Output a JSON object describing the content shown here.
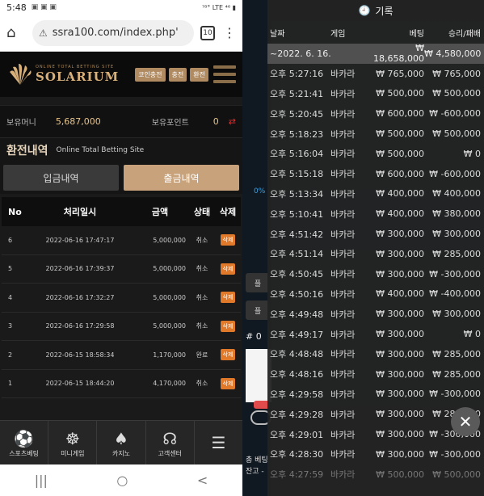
{
  "left": {
    "status": {
      "time": "5:48",
      "icons": "▣ ▣ ▣",
      "right": "⁷⁸° LTE ⁴⁶ ▮"
    },
    "browser": {
      "url": "ssra100.com/index.php'",
      "tab_count": "10"
    },
    "site": {
      "brand_tag": "ONLINE TOTAL BETTING SITE",
      "brand_name": "SOLARIUM",
      "buttons": [
        "코인충전",
        "충전",
        "환전"
      ]
    },
    "balance": {
      "money_label": "보유머니",
      "money": "5,687,000",
      "points_label": "보유포인트",
      "points": "0",
      "transfer_icon": "⇄"
    },
    "section": {
      "title": "환전내역",
      "subtitle": "Online Total Betting Site"
    },
    "tabs": [
      "입금내역",
      "출금내역"
    ],
    "table": {
      "headers": [
        "No",
        "처리일시",
        "금액",
        "상태",
        "삭제"
      ],
      "rows": [
        {
          "no": "6",
          "datetime": "2022-06-16 17:47:17",
          "amount": "5,000,000",
          "status": "취소",
          "del": "삭제"
        },
        {
          "no": "5",
          "datetime": "2022-06-16 17:39:37",
          "amount": "5,000,000",
          "status": "취소",
          "del": "삭제"
        },
        {
          "no": "4",
          "datetime": "2022-06-16 17:32:27",
          "amount": "5,000,000",
          "status": "취소",
          "del": "삭제"
        },
        {
          "no": "3",
          "datetime": "2022-06-16 17:29:58",
          "amount": "5,000,000",
          "status": "취소",
          "del": "삭제"
        },
        {
          "no": "2",
          "datetime": "2022-06-15 18:58:34",
          "amount": "1,170,000",
          "status": "완료",
          "del": "삭제"
        },
        {
          "no": "1",
          "datetime": "2022-06-15 18:44:20",
          "amount": "4,170,000",
          "status": "취소",
          "del": "삭제"
        }
      ]
    },
    "bottomnav": [
      {
        "label": "스포츠베팅",
        "icon": "⚽"
      },
      {
        "label": "미니게임",
        "icon": "☸"
      },
      {
        "label": "카지노",
        "icon": "♠"
      },
      {
        "label": "고객센터",
        "icon": "☊"
      },
      {
        "label": "",
        "icon": "☰"
      }
    ],
    "sysnav": [
      "|||",
      "○",
      "<"
    ]
  },
  "right": {
    "side": {
      "pct": "0%",
      "chip1": "플",
      "chip2": "플",
      "hash": "# 0",
      "line1": "총 베팅",
      "line2": "잔고 -"
    },
    "title": "기록",
    "headers": [
      "날짜",
      "게임",
      "베팅",
      "승리/패배"
    ],
    "summary": {
      "date": "~2022. 6. 16.",
      "game": "",
      "bet": "₩ 18,658,000",
      "win": "₩ 4,580,000"
    },
    "rows": [
      {
        "date": "오후 5:27:16",
        "game": "바카라",
        "bet": "₩ 765,000",
        "win": "₩ 765,000"
      },
      {
        "date": "오후 5:21:41",
        "game": "바카라",
        "bet": "₩ 500,000",
        "win": "₩ 500,000"
      },
      {
        "date": "오후 5:20:45",
        "game": "바카라",
        "bet": "₩ 600,000",
        "win": "₩ -600,000"
      },
      {
        "date": "오후 5:18:23",
        "game": "바카라",
        "bet": "₩ 500,000",
        "win": "₩ 500,000"
      },
      {
        "date": "오후 5:16:04",
        "game": "바카라",
        "bet": "₩ 500,000",
        "win": "₩ 0"
      },
      {
        "date": "오후 5:15:18",
        "game": "바카라",
        "bet": "₩ 600,000",
        "win": "₩ -600,000"
      },
      {
        "date": "오후 5:13:34",
        "game": "바카라",
        "bet": "₩ 400,000",
        "win": "₩ 400,000"
      },
      {
        "date": "오후 5:10:41",
        "game": "바카라",
        "bet": "₩ 400,000",
        "win": "₩ 380,000"
      },
      {
        "date": "오후 4:51:42",
        "game": "바카라",
        "bet": "₩ 300,000",
        "win": "₩ 300,000"
      },
      {
        "date": "오후 4:51:14",
        "game": "바카라",
        "bet": "₩ 300,000",
        "win": "₩ 285,000"
      },
      {
        "date": "오후 4:50:45",
        "game": "바카라",
        "bet": "₩ 300,000",
        "win": "₩ -300,000"
      },
      {
        "date": "오후 4:50:16",
        "game": "바카라",
        "bet": "₩ 400,000",
        "win": "₩ -400,000"
      },
      {
        "date": "오후 4:49:48",
        "game": "바카라",
        "bet": "₩ 300,000",
        "win": "₩ 300,000"
      },
      {
        "date": "오후 4:49:17",
        "game": "바카라",
        "bet": "₩ 300,000",
        "win": "₩ 0"
      },
      {
        "date": "오후 4:48:48",
        "game": "바카라",
        "bet": "₩ 300,000",
        "win": "₩ 285,000"
      },
      {
        "date": "오후 4:48:16",
        "game": "바카라",
        "bet": "₩ 300,000",
        "win": "₩ 285,000"
      },
      {
        "date": "오후 4:29:58",
        "game": "바카라",
        "bet": "₩ 300,000",
        "win": "₩ -300,000"
      },
      {
        "date": "오후 4:29:28",
        "game": "바카라",
        "bet": "₩ 300,000",
        "win": "₩ 285,000"
      },
      {
        "date": "오후 4:29:01",
        "game": "바카라",
        "bet": "₩ 300,000",
        "win": "₩ -300,000"
      },
      {
        "date": "오후 4:28:30",
        "game": "바카라",
        "bet": "₩ 300,000",
        "win": "₩ -300,000"
      },
      {
        "date": "오후 4:27:59",
        "game": "바카라",
        "bet": "₩ 500,000",
        "win": "₩ 500,000"
      }
    ],
    "close_icon": "✕"
  },
  "colors": {
    "accent_gold": "#c8a27a",
    "delete_orange": "#e07a2a",
    "brand_gold": "#d7b07a"
  }
}
